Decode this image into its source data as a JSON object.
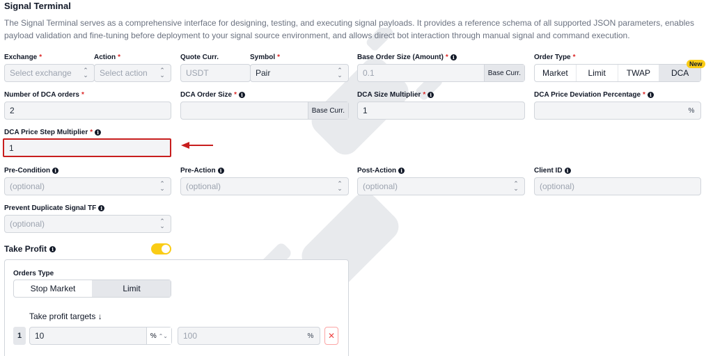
{
  "header": {
    "title": "Signal Terminal",
    "description": "The Signal Terminal serves as a comprehensive interface for designing, testing, and executing signal payloads. It provides a reference schema of all supported JSON parameters, enables payload validation and fine-tuning before deployment to your signal source environment, and allows direct bot interaction through manual signal and command execution."
  },
  "required_mark": "*",
  "fields": {
    "exchange": {
      "label": "Exchange",
      "placeholder": "Select exchange"
    },
    "action": {
      "label": "Action",
      "placeholder": "Select action"
    },
    "quote_currency": {
      "label": "Quote Curr.",
      "value": "USDT"
    },
    "symbol": {
      "label": "Symbol",
      "value": "Pair"
    },
    "base_order_size": {
      "label": "Base Order Size (Amount)",
      "placeholder": "0.1",
      "unit": "Base Curr."
    },
    "order_type": {
      "label": "Order Type",
      "options": [
        "Market",
        "Limit",
        "TWAP",
        "DCA"
      ],
      "selected": "DCA",
      "badge": "New"
    },
    "dca_orders": {
      "label": "Number of DCA orders",
      "value": "2"
    },
    "dca_order_size": {
      "label": "DCA Order Size",
      "value": "",
      "unit": "Base Curr."
    },
    "dca_size_multiplier": {
      "label": "DCA Size Multiplier",
      "value": "1"
    },
    "dca_price_deviation": {
      "label": "DCA Price Deviation Percentage",
      "value": "",
      "unit": "%"
    },
    "dca_price_step": {
      "label": "DCA Price Step Multiplier",
      "value": "1"
    },
    "pre_condition": {
      "label": "Pre-Condition",
      "placeholder": "(optional)"
    },
    "pre_action": {
      "label": "Pre-Action",
      "placeholder": "(optional)"
    },
    "post_action": {
      "label": "Post-Action",
      "placeholder": "(optional)"
    },
    "client_id": {
      "label": "Client ID",
      "placeholder": "(optional)"
    },
    "prevent_duplicate": {
      "label": "Prevent Duplicate Signal TF",
      "placeholder": "(optional)"
    }
  },
  "take_profit": {
    "title": "Take Profit",
    "enabled": true,
    "orders_type_label": "Orders Type",
    "orders_type_options": [
      "Stop Market",
      "Limit"
    ],
    "orders_type_selected": "Limit",
    "targets_label": "Take profit targets ↓",
    "targets": [
      {
        "index": "1",
        "value": "10",
        "unit": "%",
        "size_placeholder": "100",
        "size_unit": "%"
      }
    ],
    "delete_symbol": "✕"
  },
  "icons": {
    "info": "info-icon",
    "chevron": "chevron-updown-icon",
    "arrow": "arrow-left-icon",
    "watermark": "plug-icon"
  },
  "colors": {
    "accent": "#facc15",
    "required": "#dc2626",
    "highlight": "#c81e1e"
  }
}
